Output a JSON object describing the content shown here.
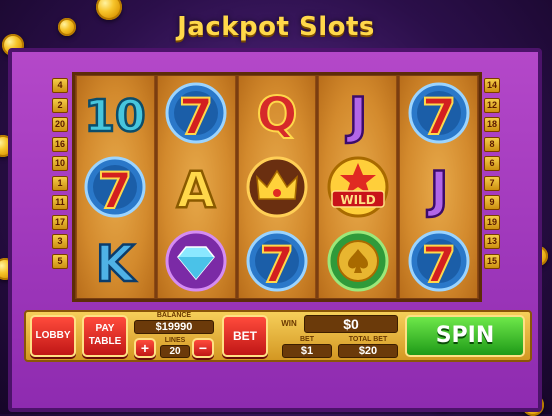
{
  "title": "Jackpot Slots",
  "paylines_left": [
    "4",
    "2",
    "20",
    "16",
    "10",
    "1",
    "11",
    "17",
    "3",
    "5"
  ],
  "paylines_right": [
    "14",
    "12",
    "18",
    "8",
    "6",
    "7",
    "9",
    "19",
    "13",
    "15"
  ],
  "reels": [
    [
      "ten",
      "seven",
      "king"
    ],
    [
      "seven",
      "ace",
      "diamond"
    ],
    [
      "queen",
      "crown",
      "seven"
    ],
    [
      "jack",
      "wild",
      "coin-spade"
    ],
    [
      "seven",
      "jack",
      "seven"
    ]
  ],
  "wild_label": "WILD",
  "controls": {
    "lobby": "LOBBY",
    "pay_table_line1": "PAY",
    "pay_table_line2": "TABLE",
    "balance_label": "BALANCE",
    "balance_value": "$19990",
    "lines_label": "LINES",
    "lines_value": "20",
    "plus": "+",
    "minus": "−",
    "bet_button": "BET",
    "win_label": "WIN",
    "win_value": "$0",
    "bet_label": "BET",
    "bet_value": "$1",
    "total_bet_label": "TOTAL BET",
    "total_bet_value": "$20",
    "spin": "SPIN"
  },
  "colors": {
    "gold": "#ffd84a",
    "frame": "#a63cc2",
    "spin": "#2fb52a",
    "red": "#e02a22"
  }
}
